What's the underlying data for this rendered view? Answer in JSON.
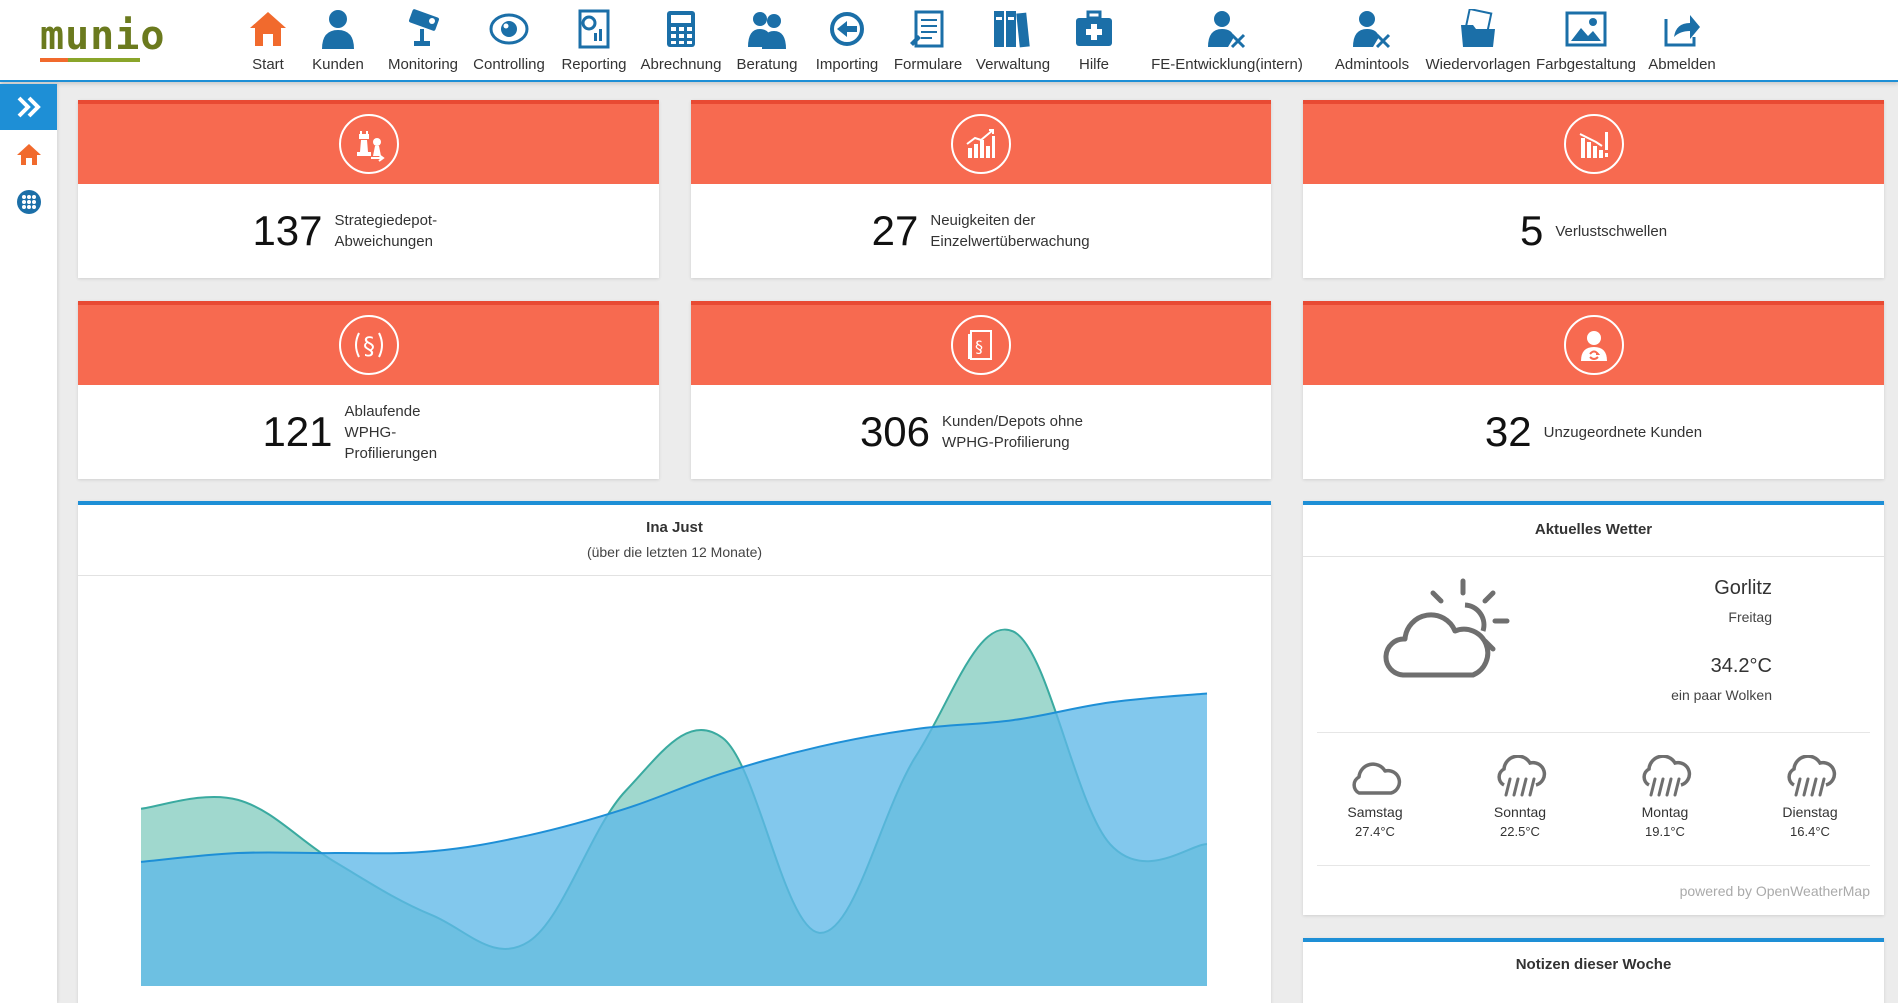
{
  "app": {
    "logo_text": "munio"
  },
  "nav": {
    "items": [
      {
        "label": "Start",
        "icon": "home-icon"
      },
      {
        "label": "Kunden",
        "icon": "user-icon"
      },
      {
        "label": "Monitoring",
        "icon": "camera-icon"
      },
      {
        "label": "Controlling",
        "icon": "eye-icon"
      },
      {
        "label": "Reporting",
        "icon": "report-icon"
      },
      {
        "label": "Abrechnung",
        "icon": "calculator-icon"
      },
      {
        "label": "Beratung",
        "icon": "consulting-icon"
      },
      {
        "label": "Importing",
        "icon": "import-icon"
      },
      {
        "label": "Formulare",
        "icon": "form-icon"
      },
      {
        "label": "Verwaltung",
        "icon": "binders-icon"
      },
      {
        "label": "Hilfe",
        "icon": "first-aid-icon"
      },
      {
        "label": "FE-Entwicklung(intern)",
        "icon": "dev-tools-icon"
      },
      {
        "label": "Admintools",
        "icon": "admin-tools-icon"
      },
      {
        "label": "Wiedervorlagen",
        "icon": "folder-icon"
      },
      {
        "label": "Farbgestaltung",
        "icon": "image-icon"
      },
      {
        "label": "Abmelden",
        "icon": "logout-icon"
      }
    ]
  },
  "colors": {
    "accent": "#1e8fd6",
    "nav_icon": "#1b6fa8",
    "home": "#f16a2d",
    "card_head": "#f76a50",
    "card_border": "#e84a33"
  },
  "cards": [
    {
      "value": "137",
      "label": "Strategiedepot-Abweichungen",
      "icon": "chess-icon"
    },
    {
      "value": "27",
      "label": "Neuigkeiten der Einzelwertüberwachung",
      "icon": "bar-chart-icon"
    },
    {
      "value": "5",
      "label": "Verlustschwellen",
      "icon": "loss-chart-icon"
    },
    {
      "value": "121",
      "label": "Ablaufende WPHG-Profilierungen",
      "icon": "paragraph-icon"
    },
    {
      "value": "306",
      "label": "Kunden/Depots ohne WPHG-Profilierung",
      "icon": "law-book-icon"
    },
    {
      "value": "32",
      "label": "Unzugeordnete Kunden",
      "icon": "unassigned-user-icon"
    }
  ],
  "chart_panel": {
    "title": "Ina Just",
    "subtitle": "(über die letzten 12 Monate)"
  },
  "chart_data": {
    "type": "area",
    "x": [
      1,
      2,
      3,
      4,
      5,
      6,
      7,
      8,
      9,
      10,
      11,
      12
    ],
    "series": [
      {
        "values": [
          10,
          10.5,
          7,
          4,
          2.5,
          11,
          14,
          3,
          13,
          20,
          8,
          8
        ],
        "color": "#8fd1c6"
      },
      {
        "values": [
          7,
          7.5,
          7.5,
          7.6,
          8.5,
          10,
          12,
          13.5,
          14.5,
          15,
          16,
          16.5
        ],
        "color": "#5fb8e8"
      }
    ],
    "ylim": [
      0,
      22
    ],
    "grid": false
  },
  "weather": {
    "title": "Aktuelles Wetter",
    "city": "Gorlitz",
    "day": "Freitag",
    "temp": "34.2°C",
    "desc": "ein paar Wolken",
    "icon": "partly-cloudy-icon",
    "forecast": [
      {
        "day": "Samstag",
        "temp": "27.4°C",
        "icon": "cloud-icon"
      },
      {
        "day": "Sonntag",
        "temp": "22.5°C",
        "icon": "rain-icon"
      },
      {
        "day": "Montag",
        "temp": "19.1°C",
        "icon": "rain-icon"
      },
      {
        "day": "Dienstag",
        "temp": "16.4°C",
        "icon": "rain-icon"
      }
    ],
    "credit": "powered by OpenWeatherMap"
  },
  "notes": {
    "title": "Notizen dieser Woche"
  }
}
